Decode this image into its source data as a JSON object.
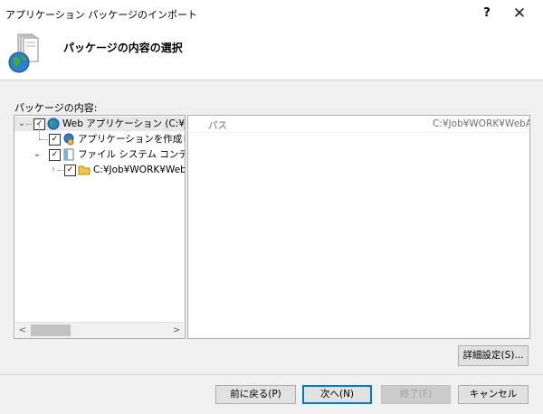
{
  "window": {
    "title": "アプリケーション パッケージのインポート",
    "help_label": "?",
    "close_label": "✕"
  },
  "header": {
    "title": "パッケージの内容の選択",
    "icon": "package-globe-icon"
  },
  "content_label": "パッケージの内容:",
  "tree": {
    "items": [
      {
        "label": "Web アプリケーション (C:¥Job¥WORK¥WebApp)",
        "checked": true,
        "expanded": true,
        "icon": "globe-icon"
      },
      {
        "label": "アプリケーションを作成します",
        "checked": true,
        "icon": "app-gear-icon"
      },
      {
        "label": "ファイル システム コンテンツ (C:¥Job¥WORK¥WebApp)",
        "checked": true,
        "expanded": true,
        "icon": "file-system-icon"
      },
      {
        "label": "C:¥Job¥WORK¥WebApp",
        "checked": true,
        "expanded": false,
        "icon": "folder-icon"
      }
    ],
    "scroll_left": "<",
    "scroll_right": ">"
  },
  "details": {
    "key": "パス",
    "value": "C:¥Job¥WORK¥WebApp"
  },
  "buttons": {
    "advanced": "詳細設定(S)...",
    "back": "前に戻る(P)",
    "next": "次へ(N)",
    "finish": "終了(F)",
    "cancel": "キャンセル"
  },
  "colors": {
    "accent": "#0078d7",
    "dialog_bg": "#f0f0f0"
  }
}
